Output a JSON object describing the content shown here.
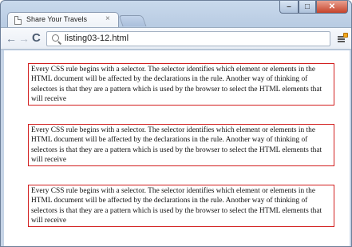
{
  "window": {
    "controls": {
      "minimize": "–",
      "maximize": "□",
      "close": "✕"
    }
  },
  "tabs": [
    {
      "title": "Share Your Travels",
      "close": "×"
    }
  ],
  "toolbar": {
    "back": "←",
    "forward": "→",
    "reload": "C",
    "url": "listing03-12.html",
    "icons": [
      "back-arrow-icon",
      "forward-arrow-icon",
      "reload-icon",
      "search-icon",
      "menu-icon"
    ],
    "badge_color": "#f2a71a"
  },
  "content": {
    "border_color": "#d21f1f",
    "paragraphs": [
      "Every CSS rule begins with a selector. The selector identifies which element or elements in the HTML document will be affected by the declarations in the rule. Another way of thinking of selectors is that they are a pattern which is used by the browser to select the HTML elements that will receive",
      "Every CSS rule begins with a selector. The selector identifies which element or elements in the HTML document will be affected by the declarations in the rule. Another way of thinking of selectors is that they are a pattern which is used by the browser to select the HTML elements that will receive",
      "Every CSS rule begins with a selector. The selector identifies which element or elements in the HTML document will be affected by the declarations in the rule. Another way of thinking of selectors is that they are a pattern which is used by the browser to select the HTML elements that will receive"
    ]
  }
}
